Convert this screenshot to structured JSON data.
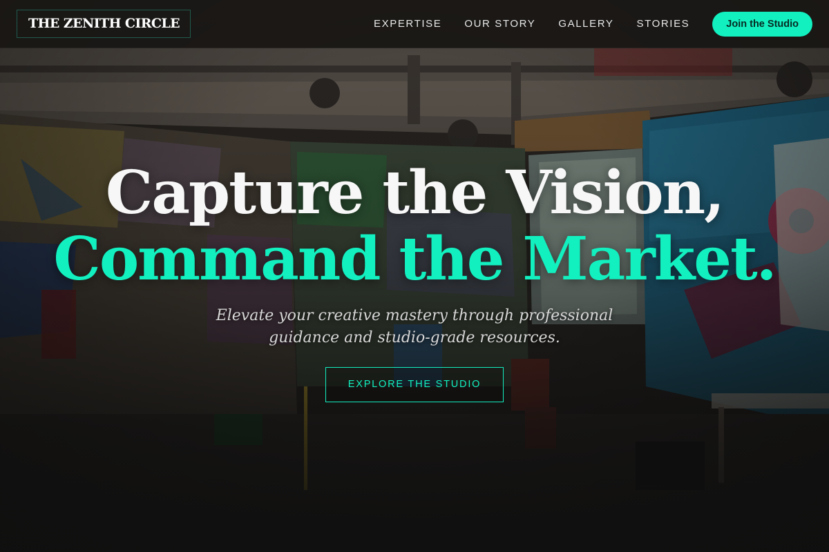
{
  "brand": {
    "name": "THE ZENITH CIRCLE"
  },
  "nav": {
    "links": [
      "EXPERTISE",
      "OUR STORY",
      "GALLERY",
      "STORIES"
    ],
    "cta_label": "Join the Studio"
  },
  "hero": {
    "headline_line1": "Capture the Vision,",
    "headline_line2": "Command the Market.",
    "subheading": "Elevate your creative mastery through professional guidance and studio-grade resources.",
    "button_label": "EXPLORE THE STUDIO",
    "background_image": "graffiti-art-studio-photo"
  },
  "colors": {
    "accent": "#12f0c0",
    "nav_background": "#1a1816",
    "page_background": "#0d0d0d"
  }
}
